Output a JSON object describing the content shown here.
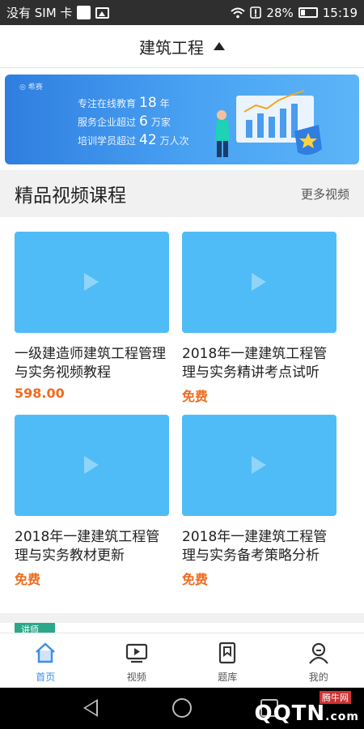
{
  "status_bar": {
    "carrier": "没有 SIM 卡",
    "battery": "28%",
    "time": "15:19"
  },
  "header": {
    "title": "建筑工程"
  },
  "banner": {
    "brand": "◎ 希赛",
    "line1_pre": "专注在线教育",
    "line1_num": "18",
    "line1_post": "年",
    "line2_pre": "服务企业超过",
    "line2_num": "6",
    "line2_post": "万家",
    "line3_pre": "培训学员超过",
    "line3_num": "42",
    "line3_post": "万人次"
  },
  "section": {
    "title": "精品视频课程",
    "more": "更多视频"
  },
  "courses": [
    {
      "title": "一级建造师建筑工程管理与实务视频教程",
      "price": "598.00"
    },
    {
      "title": "2018年一建建筑工程管理与实务精讲考点试听",
      "price": "免费"
    },
    {
      "title": "2018年一建建筑工程管理与实务教材更新",
      "price": "免费"
    },
    {
      "title": "2018年一建建筑工程管理与实务备考策略分析",
      "price": "免费"
    }
  ],
  "teaser_label": "讲师",
  "tabs": [
    {
      "label": "首页",
      "icon": "home-icon"
    },
    {
      "label": "视频",
      "icon": "video-icon"
    },
    {
      "label": "题库",
      "icon": "question-bank-icon"
    },
    {
      "label": "我的",
      "icon": "profile-icon"
    }
  ],
  "watermark": {
    "text": "QQTN",
    "suffix": ".com",
    "sub": "腾牛网"
  },
  "colors": {
    "accent": "#3b8fe6",
    "price": "#ef6b1e",
    "thumb": "#4fbcf7"
  }
}
